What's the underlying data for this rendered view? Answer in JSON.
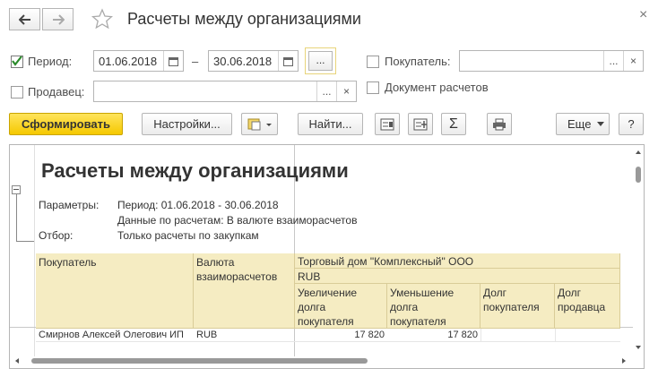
{
  "window": {
    "title": "Расчеты между организациями",
    "close_glyph": "×"
  },
  "filters": {
    "period_label": "Период:",
    "period_checked": true,
    "date_from": "01.06.2018",
    "date_to": "30.06.2018",
    "dash": "–",
    "more_button": "...",
    "seller_label": "Продавец:",
    "seller_value": "",
    "buyer_label": "Покупатель:",
    "buyer_value": "",
    "settlement_doc_label": "Документ расчетов",
    "dots": "...",
    "clear": "×"
  },
  "toolbar": {
    "generate": "Сформировать",
    "settings": "Настройки...",
    "find": "Найти...",
    "sum_glyph": "Σ",
    "more": "Еще",
    "help": "?"
  },
  "report": {
    "title": "Расчеты между организациями",
    "params_label": "Параметры:",
    "params_value": "Период: 01.06.2018 - 30.06.2018",
    "params_value2": "Данные по расчетам: В валюте взаиморасчетов",
    "filter_label": "Отбор:",
    "filter_value": "Только расчеты по закупкам",
    "headers": {
      "buyer": "Покупатель",
      "currency_l1": "Валюта",
      "currency_l2": "взаиморасчетов",
      "org": "Торговый дом \"Комплексный\" ООО",
      "org_currency": "RUB",
      "inc_l1": "Увеличение",
      "inc_l2": "долга",
      "inc_l3": "покупателя",
      "dec_l1": "Уменьшение",
      "dec_l2": "долга",
      "dec_l3": "покупателя",
      "debt_buyer_l1": "Долг",
      "debt_buyer_l2": "покупателя",
      "debt_seller_l1": "Долг",
      "debt_seller_l2": "продавца"
    },
    "rows": [
      {
        "buyer": "Смирнов Алексей Олегович ИП",
        "currency": "RUB",
        "increase": "17 820",
        "decrease": "17 820",
        "debt_buyer": "",
        "debt_seller": ""
      }
    ]
  }
}
